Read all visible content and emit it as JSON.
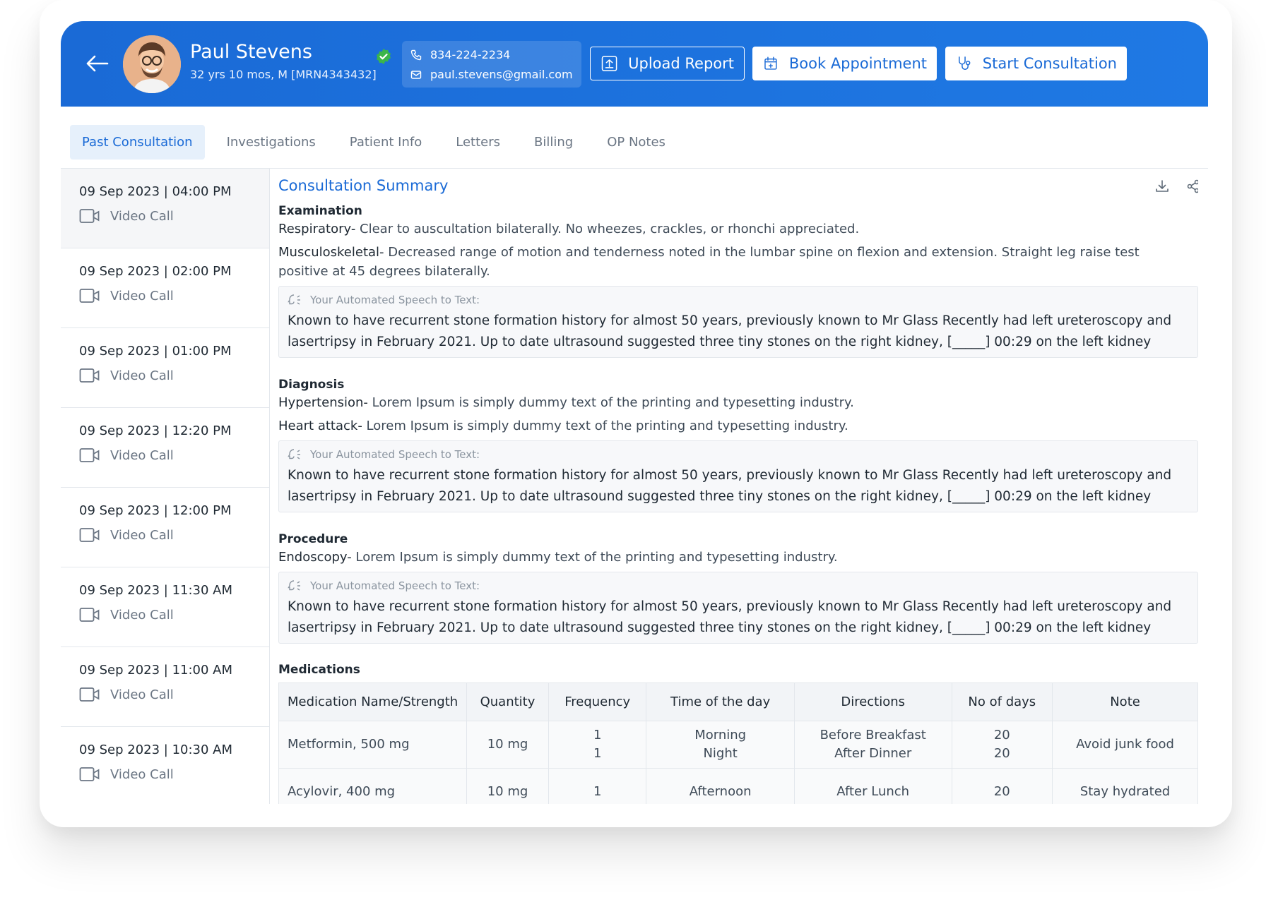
{
  "patient": {
    "name": "Paul Stevens",
    "meta": "32 yrs 10 mos, M [MRN4343432]",
    "phone": "834-224-2234",
    "email": "paul.stevens@gmail.com"
  },
  "header_actions": {
    "upload": "Upload Report",
    "book": "Book Appointment",
    "start": "Start Consultation"
  },
  "tabs": [
    "Past Consultation",
    "Investigations",
    "Patient Info",
    "Letters",
    "Billing",
    "OP Notes"
  ],
  "active_tab": "Past Consultation",
  "visits": [
    {
      "date": "09 Sep 2023 | 04:00 PM",
      "type": "Video Call"
    },
    {
      "date": "09 Sep 2023 | 02:00 PM",
      "type": "Video Call"
    },
    {
      "date": "09 Sep 2023 | 01:00 PM",
      "type": "Video Call"
    },
    {
      "date": "09 Sep 2023 | 12:20 PM",
      "type": "Video Call"
    },
    {
      "date": "09 Sep 2023 | 12:00 PM",
      "type": "Video Call"
    },
    {
      "date": "09 Sep 2023 | 11:30 AM",
      "type": "Video Call"
    },
    {
      "date": "09 Sep 2023 | 11:00 AM",
      "type": "Video Call"
    },
    {
      "date": "09 Sep 2023 | 10:30 AM",
      "type": "Video Call"
    }
  ],
  "summary": {
    "title": "Consultation Summary",
    "speech_label": "Your Automated Speech to Text:",
    "speech_text": "Known to have recurrent stone formation history for almost 50 years, previously known to Mr Glass Recently had left ureteroscopy and lasertripsy in February 2021. Up to date ultrasound suggested three tiny stones on the right kidney, [_____] 00:29 on the left kidney",
    "examination": {
      "title": "Examination",
      "items": [
        {
          "label": "Respiratory-",
          "text": " Clear to auscultation bilaterally. No wheezes, crackles, or rhonchi appreciated."
        },
        {
          "label": "Musculoskeletal-",
          "text": " Decreased range of motion and tenderness noted in the lumbar spine on flexion and extension. Straight leg raise test positive at 45 degrees bilaterally."
        }
      ]
    },
    "diagnosis": {
      "title": "Diagnosis",
      "items": [
        {
          "label": "Hypertension-",
          "text": " Lorem Ipsum is simply dummy text of the printing and typesetting industry."
        },
        {
          "label": "Heart attack-",
          "text": " Lorem Ipsum is simply dummy text of the printing and typesetting industry."
        }
      ]
    },
    "procedure": {
      "title": "Procedure",
      "items": [
        {
          "label": "Endoscopy-",
          "text": " Lorem Ipsum is simply dummy text of the printing and typesetting industry."
        }
      ]
    },
    "medications": {
      "title": "Medications",
      "headers": [
        "Medication Name/Strength",
        "Quantity",
        "Frequency",
        "Time of the day",
        "Directions",
        "No of days",
        "Note"
      ],
      "rows": [
        [
          "Metformin, 500 mg",
          "10 mg",
          "1\n1",
          "Morning\nNight",
          "Before Breakfast\nAfter  Dinner",
          "20\n20",
          "Avoid junk food"
        ],
        [
          "Acylovir, 400 mg",
          "10 mg",
          "1",
          "Afternoon",
          "After Lunch",
          "20",
          "Stay hydrated"
        ]
      ]
    }
  },
  "colors": {
    "primary": "#1a6ad6",
    "verified": "#3bb54a"
  }
}
